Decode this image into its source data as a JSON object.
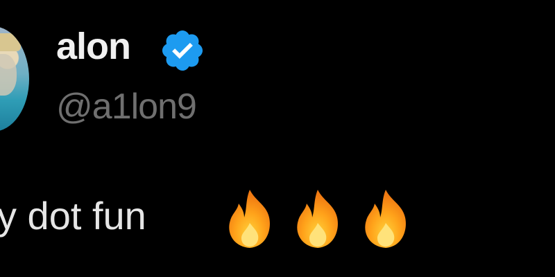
{
  "tweet": {
    "author": {
      "display_name": "alon",
      "handle": "@a1lon9",
      "verified": true,
      "verified_color": "#1d9bf0",
      "avatar_icon": "avatar-image"
    },
    "text": "y dot fun",
    "emojis": [
      "fire-icon",
      "fire-icon",
      "fire-icon"
    ]
  },
  "colors": {
    "background": "#000000",
    "name": "#f0f0f0",
    "handle": "#6f6f6f",
    "body_text": "#e6e6e6"
  }
}
